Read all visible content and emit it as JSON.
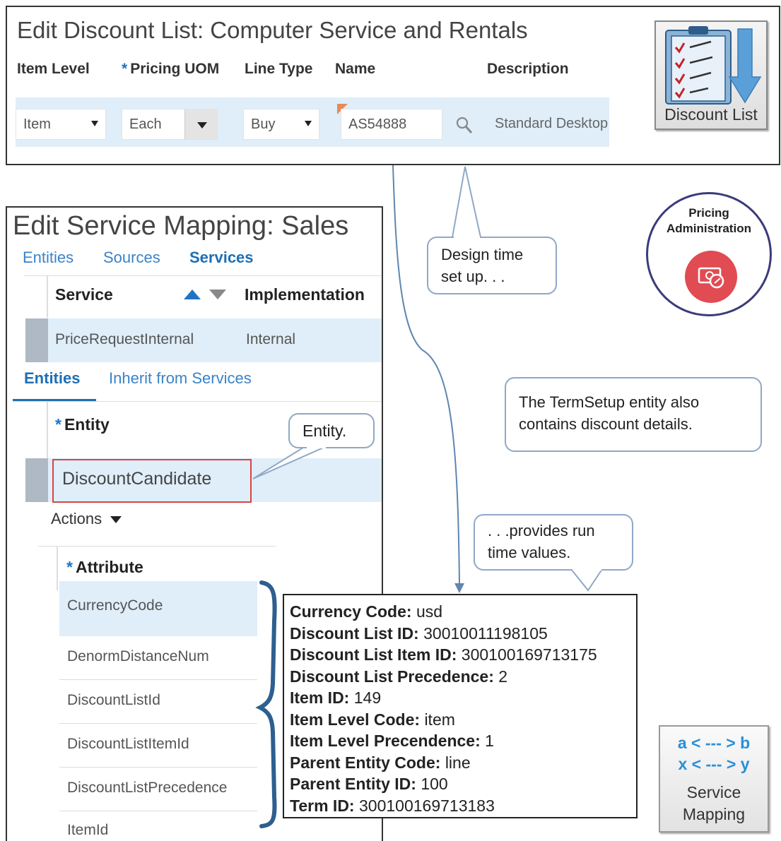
{
  "discount_list": {
    "title": "Edit Discount List: Computer Service and Rentals",
    "headers": {
      "item_level": "Item Level",
      "pricing_uom": "Pricing UOM",
      "line_type": "Line Type",
      "name": "Name",
      "description": "Description"
    },
    "required_marker": "*",
    "row": {
      "item_level": "Item",
      "pricing_uom": "Each",
      "line_type": "Buy",
      "name": "AS54888",
      "description": "Standard Desktop"
    }
  },
  "discount_list_icon": {
    "label": "Discount List"
  },
  "service_mapping_panel": {
    "title": "Edit Service Mapping: Sales",
    "tabs": [
      "Entities",
      "Sources",
      "Services"
    ],
    "active_tab": "Services",
    "services_table": {
      "columns": [
        "Service",
        "Implementation"
      ],
      "rows": [
        {
          "service": "PriceRequestInternal",
          "implementation": "Internal"
        }
      ]
    },
    "subtabs": [
      "Entities",
      "Inherit from Services"
    ],
    "entity_header": "Entity",
    "entity_value": "DiscountCandidate",
    "actions_label": "Actions",
    "attribute_header": "Attribute",
    "attributes": [
      "CurrencyCode",
      "DenormDistanceNum",
      "DiscountListId",
      "DiscountListItemId",
      "DiscountListPrecedence",
      "ItemId"
    ]
  },
  "callouts": {
    "design_time": "Design time set up. . .",
    "entity": "Entity.",
    "termsetup": "The TermSetup  entity also contains discount details.",
    "runtime": ". . .provides  run time values."
  },
  "run_time_values": [
    {
      "label": "Currency  Code:",
      "value": "usd"
    },
    {
      "label": "Discount  List ID:",
      "value": "300100111981​05"
    },
    {
      "label": "Discount  List Item ID:",
      "value": "300100169713175"
    },
    {
      "label": "Discount  List Precedence:",
      "value": "2"
    },
    {
      "label": "Item ID:",
      "value": "149"
    },
    {
      "label": "Item Level Code:",
      "value": "item"
    },
    {
      "label": "Item Level Precendence:",
      "value": "1"
    },
    {
      "label": "Parent Entity  Code:",
      "value": "line"
    },
    {
      "label": "Parent Entity  ID:",
      "value": "100"
    },
    {
      "label": "Term ID:",
      "value": "300100169713183"
    }
  ],
  "pricing_admin": {
    "line1": "Pricing",
    "line2": "Administration"
  },
  "service_mapping_icon": {
    "line1": "a < --- > b",
    "line2": "x < --- > y",
    "label_line1": "Service",
    "label_line2": "Mapping"
  },
  "colors": {
    "link_blue": "#3a83c8",
    "row_highlight": "#dfeef9",
    "callout_border": "#8fa8c6",
    "error_red": "#d64545",
    "brace_blue": "#2d5f8f"
  }
}
